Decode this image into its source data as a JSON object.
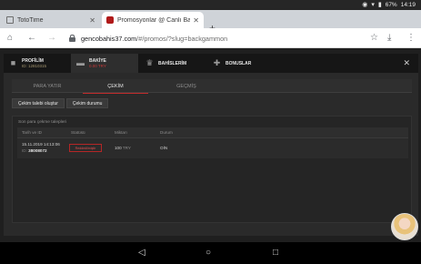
{
  "status_bar": {
    "battery": "67%",
    "time": "14:19"
  },
  "browser": {
    "tabs": [
      {
        "title": "TotoTime",
        "state": "inactive"
      },
      {
        "title": "Promosyonlar @ Canlı Bahis",
        "state": "active"
      }
    ],
    "url_host": "gencobahis37.com",
    "url_path": "/#/promos/?slug=backgammon"
  },
  "modal": {
    "header": [
      {
        "title": "PROFİLİM",
        "subtitle": "ID: 12810315"
      },
      {
        "title": "BAKİYE",
        "subtitle": "0.00 TRY"
      },
      {
        "title": "BAHİSLERİM",
        "subtitle": ""
      },
      {
        "title": "BONUSLAR",
        "subtitle": ""
      }
    ],
    "subtabs": [
      "PARA YATIR",
      "ÇEKİM",
      "GEÇMİŞ"
    ],
    "actions": [
      "Çekim talebi oluştur",
      "Çekim durumu"
    ],
    "panel_title": "Son para çekme talepleri",
    "table": {
      "headers": [
        "Tarih ve ID",
        "Statüsü",
        "Miktarı",
        "Durum"
      ],
      "rows": [
        {
          "date": "15.11.2019 14:13:06",
          "id_label": "ID:",
          "id": "38008072",
          "status": "Reddedilmiştir",
          "amount": "100",
          "currency": "TRY",
          "state": "OİN"
        }
      ]
    }
  }
}
